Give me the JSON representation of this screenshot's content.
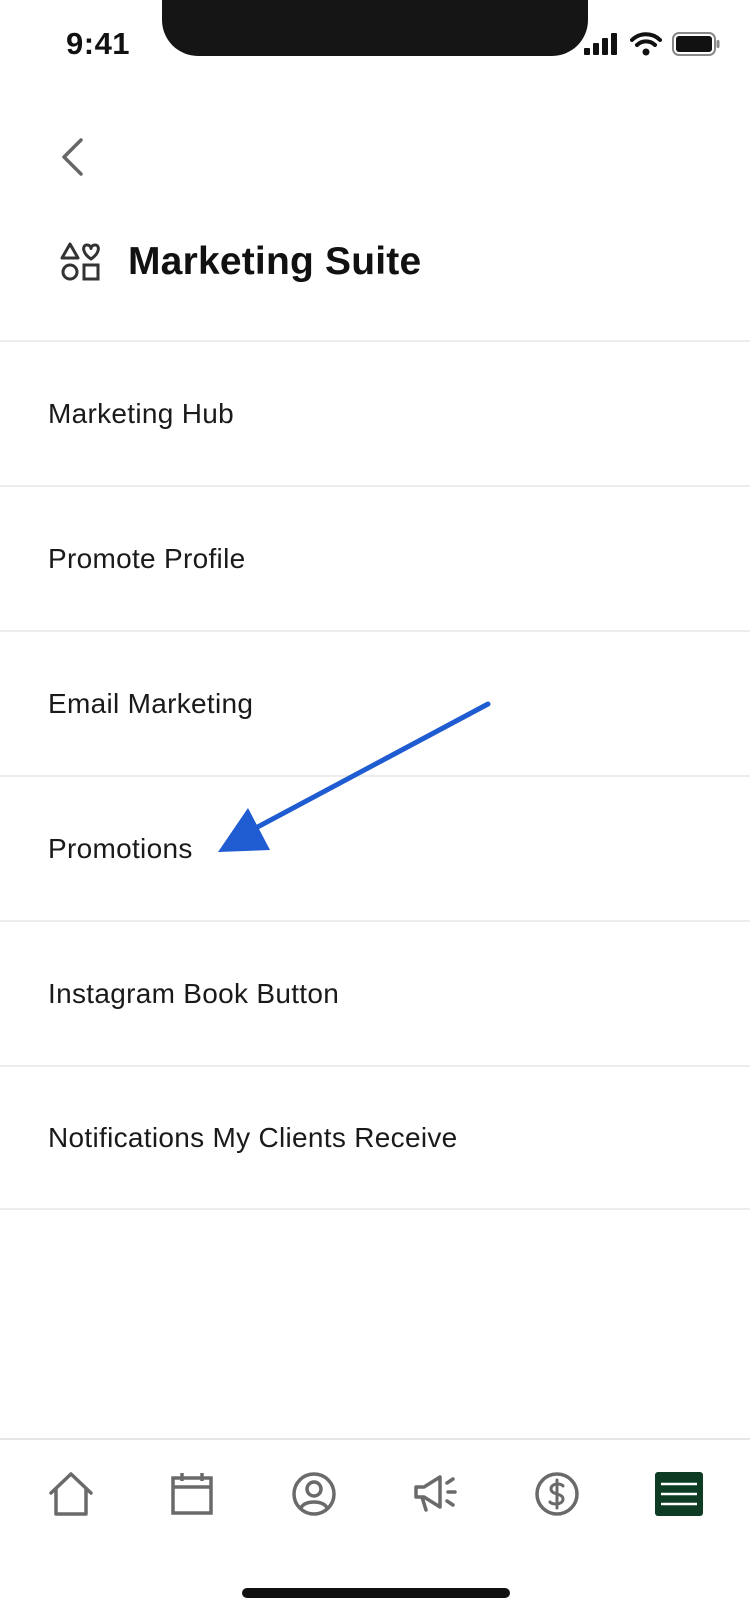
{
  "status_bar": {
    "time": "9:41"
  },
  "header": {
    "title": "Marketing Suite",
    "icon": "shapes-heart-icon"
  },
  "menu": {
    "items": [
      {
        "label": "Marketing Hub"
      },
      {
        "label": "Promote Profile"
      },
      {
        "label": "Email Marketing"
      },
      {
        "label": "Promotions"
      },
      {
        "label": "Instagram Book Button"
      },
      {
        "label": "Notifications My Clients Receive"
      }
    ]
  },
  "annotation": {
    "color": "#1f5bd1",
    "points_to": "Promotions"
  },
  "tab_bar": {
    "tabs": [
      {
        "icon": "home-icon"
      },
      {
        "icon": "calendar-icon"
      },
      {
        "icon": "profile-icon"
      },
      {
        "icon": "megaphone-icon"
      },
      {
        "icon": "dollar-icon"
      },
      {
        "icon": "menu-icon",
        "active": true
      }
    ],
    "active_color": "#0d3b24"
  }
}
